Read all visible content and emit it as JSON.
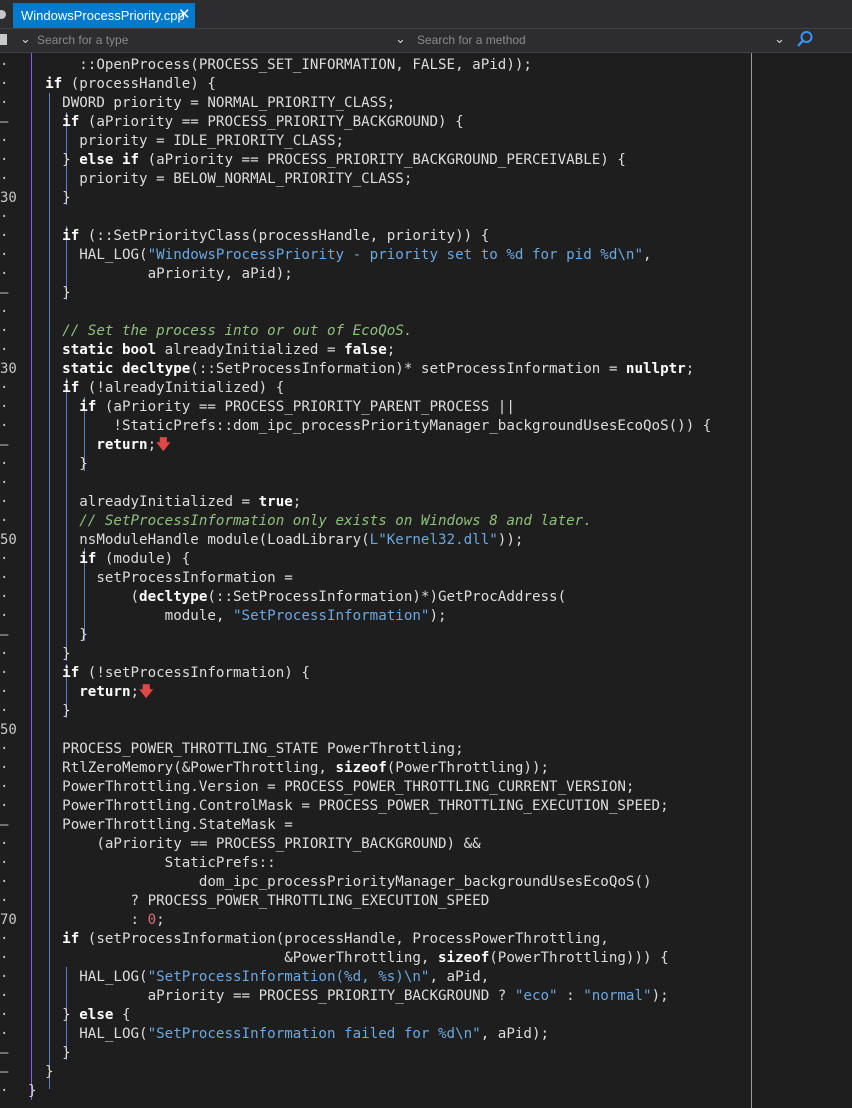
{
  "tab": {
    "label": "WindowsProcessPriority.cpp",
    "close": "✕"
  },
  "nav": {
    "type_placeholder": "Search for a type",
    "method_placeholder": "Search for a method"
  },
  "icons": [
    "file-icon",
    "chevron-down-icon",
    "search-icon",
    "close-icon"
  ],
  "colors": {
    "accent": "#007acc",
    "background": "#1e1e1e",
    "string": "#6ba7e0",
    "comment": "#8ec07c",
    "number": "#e06c75"
  },
  "gutter": [
    "·",
    "·",
    "·",
    "–",
    "·",
    "·",
    "·",
    "30",
    "·",
    "·",
    "·",
    "·",
    "–",
    "·",
    "·",
    "·",
    "30",
    "·",
    "·",
    "·",
    "–",
    "·",
    "·",
    "·",
    "·",
    "50",
    "·",
    "·",
    "·",
    "·",
    "–",
    "·",
    "·",
    "·",
    "·",
    "50",
    "·",
    "·",
    "·",
    "·",
    "–",
    "·",
    "·",
    "·",
    "·",
    "70",
    "·",
    "·",
    "·",
    "·",
    "·",
    "·",
    "–",
    "–",
    "·"
  ],
  "code": [
    [
      [
        "p",
        "      ::OpenProcess(PROCESS_SET_INFORMATION, FALSE, aPid));"
      ]
    ],
    [
      [
        "p",
        "  "
      ],
      [
        "k",
        "if"
      ],
      [
        "p",
        " (processHandle) {"
      ]
    ],
    [
      [
        "p",
        "    DWORD priority = NORMAL_PRIORITY_CLASS;"
      ]
    ],
    [
      [
        "p",
        "    "
      ],
      [
        "k",
        "if"
      ],
      [
        "p",
        " (aPriority == PROCESS_PRIORITY_BACKGROUND) {"
      ]
    ],
    [
      [
        "p",
        "      priority = IDLE_PRIORITY_CLASS;"
      ]
    ],
    [
      [
        "p",
        "    } "
      ],
      [
        "k",
        "else if"
      ],
      [
        "p",
        " (aPriority == PROCESS_PRIORITY_BACKGROUND_PERCEIVABLE) {"
      ]
    ],
    [
      [
        "p",
        "      priority = BELOW_NORMAL_PRIORITY_CLASS;"
      ]
    ],
    [
      [
        "p",
        "    }"
      ]
    ],
    [
      [
        "p",
        ""
      ]
    ],
    [
      [
        "p",
        "    "
      ],
      [
        "k",
        "if"
      ],
      [
        "p",
        " (::SetPriorityClass(processHandle, priority)) {"
      ]
    ],
    [
      [
        "p",
        "      HAL_LOG("
      ],
      [
        "s",
        "\"WindowsProcessPriority - priority set to %d for pid %d\\n\""
      ],
      [
        "p",
        ","
      ]
    ],
    [
      [
        "p",
        "              aPriority, aPid);"
      ]
    ],
    [
      [
        "p",
        "    }"
      ]
    ],
    [
      [
        "p",
        ""
      ]
    ],
    [
      [
        "c",
        "    // Set the process into or out of EcoQoS."
      ]
    ],
    [
      [
        "p",
        "    "
      ],
      [
        "k",
        "static bool"
      ],
      [
        "p",
        " alreadyInitialized = "
      ],
      [
        "k",
        "false"
      ],
      [
        "p",
        ";"
      ]
    ],
    [
      [
        "p",
        "    "
      ],
      [
        "k",
        "static decltype"
      ],
      [
        "p",
        "(::SetProcessInformation)* setProcessInformation = "
      ],
      [
        "k",
        "nullptr"
      ],
      [
        "p",
        ";"
      ]
    ],
    [
      [
        "p",
        "    "
      ],
      [
        "k",
        "if"
      ],
      [
        "p",
        " (!alreadyInitialized) {"
      ]
    ],
    [
      [
        "p",
        "      "
      ],
      [
        "k",
        "if"
      ],
      [
        "p",
        " (aPriority == PROCESS_PRIORITY_PARENT_PROCESS ||"
      ]
    ],
    [
      [
        "p",
        "          !StaticPrefs::dom_ipc_processPriorityManager_backgroundUsesEcoQoS()) {"
      ]
    ],
    [
      [
        "p",
        "        "
      ],
      [
        "k",
        "return"
      ],
      [
        "p",
        ";"
      ],
      [
        "a",
        "🡇"
      ]
    ],
    [
      [
        "p",
        "      }"
      ]
    ],
    [
      [
        "p",
        ""
      ]
    ],
    [
      [
        "p",
        "      alreadyInitialized = "
      ],
      [
        "k",
        "true"
      ],
      [
        "p",
        ";"
      ]
    ],
    [
      [
        "c",
        "      // SetProcessInformation only exists on Windows 8 and later."
      ]
    ],
    [
      [
        "p",
        "      nsModuleHandle module(LoadLibrary("
      ],
      [
        "s",
        "L\"Kernel32.dll\""
      ],
      [
        "p",
        "));"
      ]
    ],
    [
      [
        "p",
        "      "
      ],
      [
        "k",
        "if"
      ],
      [
        "p",
        " (module) {"
      ]
    ],
    [
      [
        "p",
        "        setProcessInformation ="
      ]
    ],
    [
      [
        "p",
        "            ("
      ],
      [
        "k",
        "decltype"
      ],
      [
        "p",
        "(::SetProcessInformation)*)GetProcAddress("
      ]
    ],
    [
      [
        "p",
        "                module, "
      ],
      [
        "s",
        "\"SetProcessInformation\""
      ],
      [
        "p",
        ");"
      ]
    ],
    [
      [
        "p",
        "      }"
      ]
    ],
    [
      [
        "p",
        "    }"
      ]
    ],
    [
      [
        "p",
        "    "
      ],
      [
        "k",
        "if"
      ],
      [
        "p",
        " (!setProcessInformation) {"
      ]
    ],
    [
      [
        "p",
        "      "
      ],
      [
        "k",
        "return"
      ],
      [
        "p",
        ";"
      ],
      [
        "a",
        "🡇"
      ]
    ],
    [
      [
        "p",
        "    }"
      ]
    ],
    [
      [
        "p",
        ""
      ]
    ],
    [
      [
        "p",
        "    PROCESS_POWER_THROTTLING_STATE PowerThrottling;"
      ]
    ],
    [
      [
        "p",
        "    RtlZeroMemory(&PowerThrottling, "
      ],
      [
        "k",
        "sizeof"
      ],
      [
        "p",
        "(PowerThrottling));"
      ]
    ],
    [
      [
        "p",
        "    PowerThrottling.Version = PROCESS_POWER_THROTTLING_CURRENT_VERSION;"
      ]
    ],
    [
      [
        "p",
        "    PowerThrottling.ControlMask = PROCESS_POWER_THROTTLING_EXECUTION_SPEED;"
      ]
    ],
    [
      [
        "p",
        "    PowerThrottling.StateMask ="
      ]
    ],
    [
      [
        "p",
        "        (aPriority == PROCESS_PRIORITY_BACKGROUND) &&"
      ]
    ],
    [
      [
        "p",
        "                StaticPrefs::"
      ]
    ],
    [
      [
        "p",
        "                    dom_ipc_processPriorityManager_backgroundUsesEcoQoS()"
      ]
    ],
    [
      [
        "p",
        "            ? PROCESS_POWER_THROTTLING_EXECUTION_SPEED"
      ]
    ],
    [
      [
        "p",
        "            : "
      ],
      [
        "n",
        "0"
      ],
      [
        "p",
        ";"
      ]
    ],
    [
      [
        "p",
        "    "
      ],
      [
        "k",
        "if"
      ],
      [
        "p",
        " (setProcessInformation(processHandle, ProcessPowerThrottling,"
      ]
    ],
    [
      [
        "p",
        "                              &PowerThrottling, "
      ],
      [
        "k",
        "sizeof"
      ],
      [
        "p",
        "(PowerThrottling))) {"
      ]
    ],
    [
      [
        "p",
        "      HAL_LOG("
      ],
      [
        "s",
        "\"SetProcessInformation(%d, %s)\\n\""
      ],
      [
        "p",
        ", aPid,"
      ]
    ],
    [
      [
        "p",
        "              aPriority == PROCESS_PRIORITY_BACKGROUND ? "
      ],
      [
        "s",
        "\"eco\""
      ],
      [
        "p",
        " : "
      ],
      [
        "s",
        "\"normal\""
      ],
      [
        "p",
        ");"
      ]
    ],
    [
      [
        "p",
        "    } "
      ],
      [
        "k",
        "else"
      ],
      [
        "p",
        " {"
      ]
    ],
    [
      [
        "p",
        "      HAL_LOG("
      ],
      [
        "s",
        "\"SetProcessInformation failed for %d\\n\""
      ],
      [
        "p",
        ", aPid);"
      ]
    ],
    [
      [
        "p",
        "    }"
      ]
    ],
    [
      [
        "p",
        "  }"
      ]
    ],
    [
      [
        "p",
        "}"
      ]
    ]
  ]
}
